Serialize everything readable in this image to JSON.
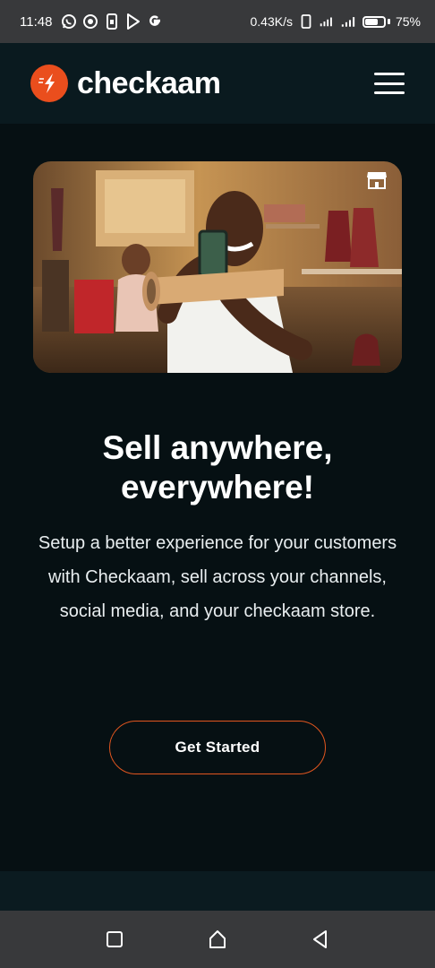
{
  "status_bar": {
    "time": "11:48",
    "net_speed": "0.43K/s",
    "battery_pct": "75%",
    "battery_level": 0.75,
    "icons": [
      "whatsapp-icon",
      "record-icon",
      "sim-icon",
      "play-store-icon",
      "google-icon",
      "phone-icon",
      "signal-icon",
      "signal-icon",
      "battery-icon"
    ]
  },
  "header": {
    "brand": "checkaam",
    "logo_icon": "lightning-logo-icon",
    "menu_icon": "hamburger-menu-icon",
    "bg_color": "#0a1a1f"
  },
  "hero": {
    "image_alt": "man holding phone and wooden carving in shop",
    "badge_icon": "store-icon"
  },
  "headline": {
    "line1": "Sell anywhere,",
    "line2": "everywhere!"
  },
  "subtext": "Setup a better experience for your customers with Checkaam, sell across your channels, social media, and your checkaam store.",
  "cta": {
    "label": "Get Started",
    "border_color": "#e2561f"
  },
  "nav_bar": {
    "icons": [
      "recents-square-icon",
      "home-icon",
      "back-triangle-icon"
    ]
  },
  "colors": {
    "background": "#061013",
    "accent": "#ea4e1d"
  }
}
